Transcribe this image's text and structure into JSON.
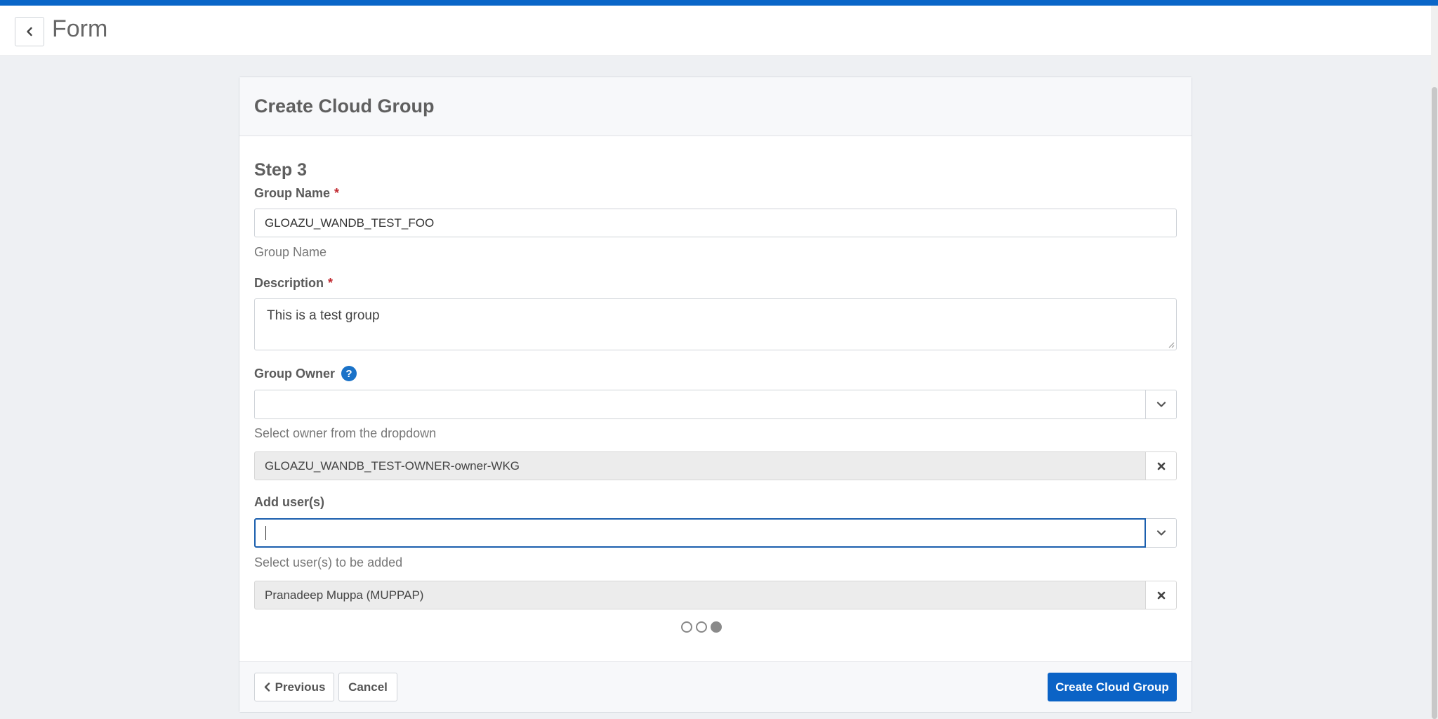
{
  "header": {
    "title": "Form"
  },
  "card": {
    "title": "Create Cloud Group",
    "step_title": "Step 3"
  },
  "group_name": {
    "label": "Group Name",
    "required_mark": "*",
    "value": "GLOAZU_WANDB_TEST_FOO",
    "help": "Group Name"
  },
  "description": {
    "label": "Description",
    "required_mark": "*",
    "value": "This is a test group"
  },
  "group_owner": {
    "label": "Group Owner",
    "help_icon": "?",
    "value": "",
    "help": "Select owner from the dropdown",
    "selected": "GLOAZU_WANDB_TEST-OWNER-owner-WKG"
  },
  "add_users": {
    "label": "Add user(s)",
    "value": "",
    "help": "Select user(s) to be added",
    "selected": "Pranadeep Muppa (MUPPAP)"
  },
  "steps": {
    "total": 3,
    "current": 3
  },
  "footer": {
    "previous_label": "Previous",
    "cancel_label": "Cancel",
    "submit_label": "Create Cloud Group"
  },
  "colors": {
    "accent": "#0a66c8",
    "primary_button": "#0b63c6",
    "required": "#c0262d",
    "help_icon": "#1a72c8"
  },
  "icons": {
    "back": "chevron-left-icon",
    "dropdown": "chevron-down-icon",
    "remove": "close-icon",
    "previous": "chevron-left-icon",
    "help": "help-icon"
  }
}
